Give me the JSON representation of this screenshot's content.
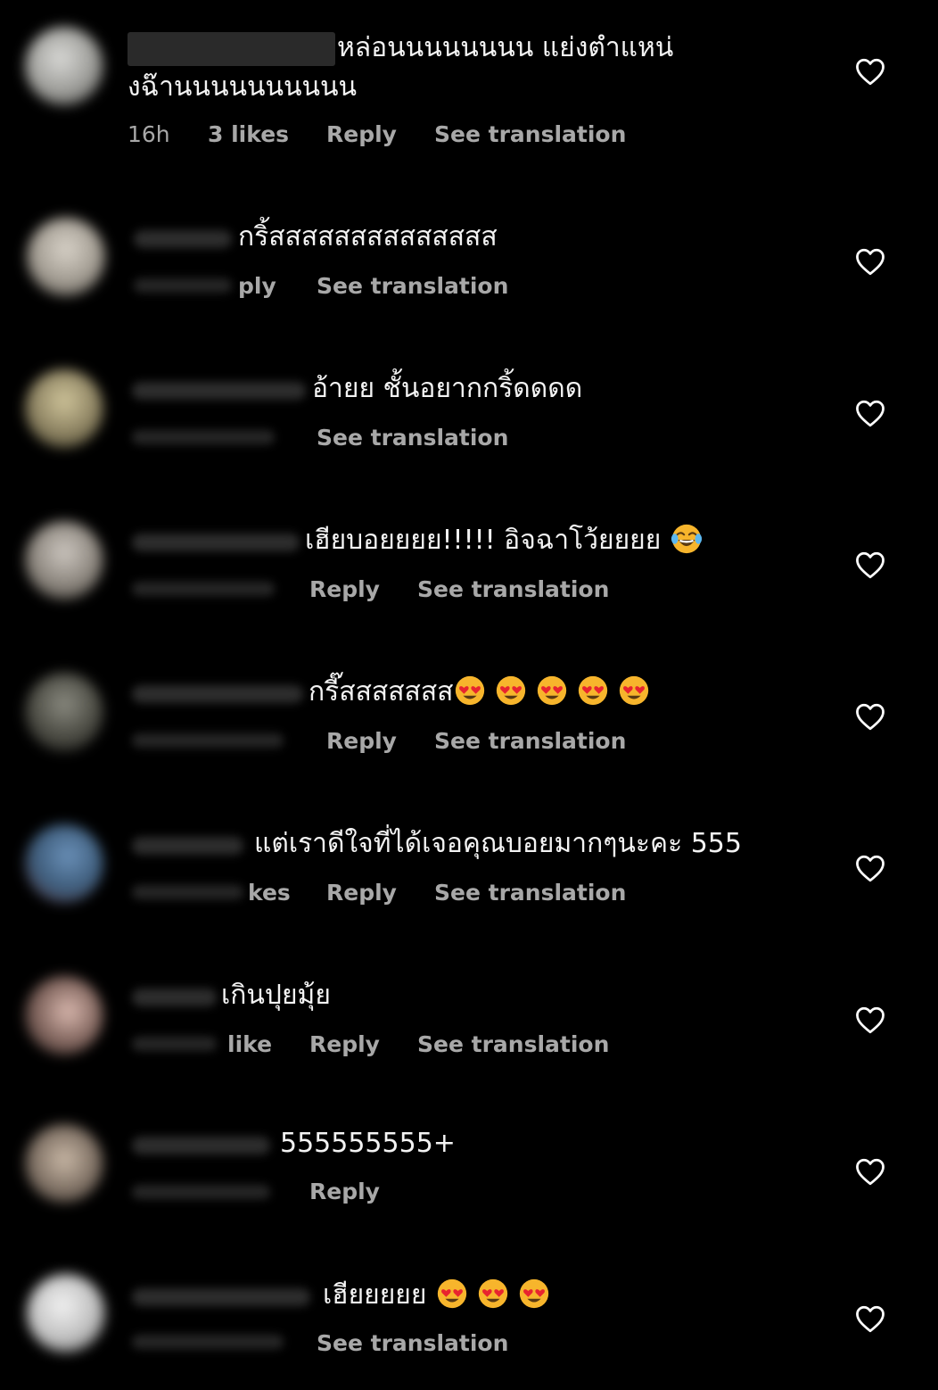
{
  "colors": {
    "background": "#000000",
    "text": "#f3f3f3",
    "meta": "#a8a8a8",
    "heart_outline": "#ffffff",
    "emoji_face": "#f7b52c",
    "emoji_heart": "#e8242f"
  },
  "icons": {
    "like": "heart-outline-icon",
    "heart_eyes": "smiling-face-with-heart-eyes-emoji",
    "tears_of_joy": "face-with-tears-of-joy-emoji"
  },
  "comments": [
    {
      "text_line1": "หล่อนนนนนนนน แย่งตำแหน่",
      "text_line2": "งฉ๊านนนนนนนนนน",
      "time": "16h",
      "likes": "3 likes",
      "reply": "Reply",
      "translate": "See translation"
    },
    {
      "text": "กริ้สสสสสสสสสสสสสส",
      "reply_partial": "ply",
      "translate": "See translation"
    },
    {
      "text": "อ้ายย ชั้นอยากกริ้ดดดด",
      "translate": "See translation"
    },
    {
      "text": "เฮียบอยยยย!!!!! อิจฉาโว้ยยยย",
      "reply": "Reply",
      "translate": "See translation"
    },
    {
      "text": "กรี๊สสสสสสส",
      "reply": "Reply",
      "translate": "See translation"
    },
    {
      "text": "แต่เราดีใจที่ได้เจอคุณบอยมากๆนะคะ 555",
      "likes_partial": "kes",
      "reply": "Reply",
      "translate": "See translation"
    },
    {
      "text": "เกินปุยมุ้ย",
      "likes_partial": "like",
      "reply": "Reply",
      "translate": "See translation"
    },
    {
      "text": "555555555+",
      "reply": "Reply"
    },
    {
      "text": "เฮียยยยย",
      "translate": "See translation"
    }
  ]
}
